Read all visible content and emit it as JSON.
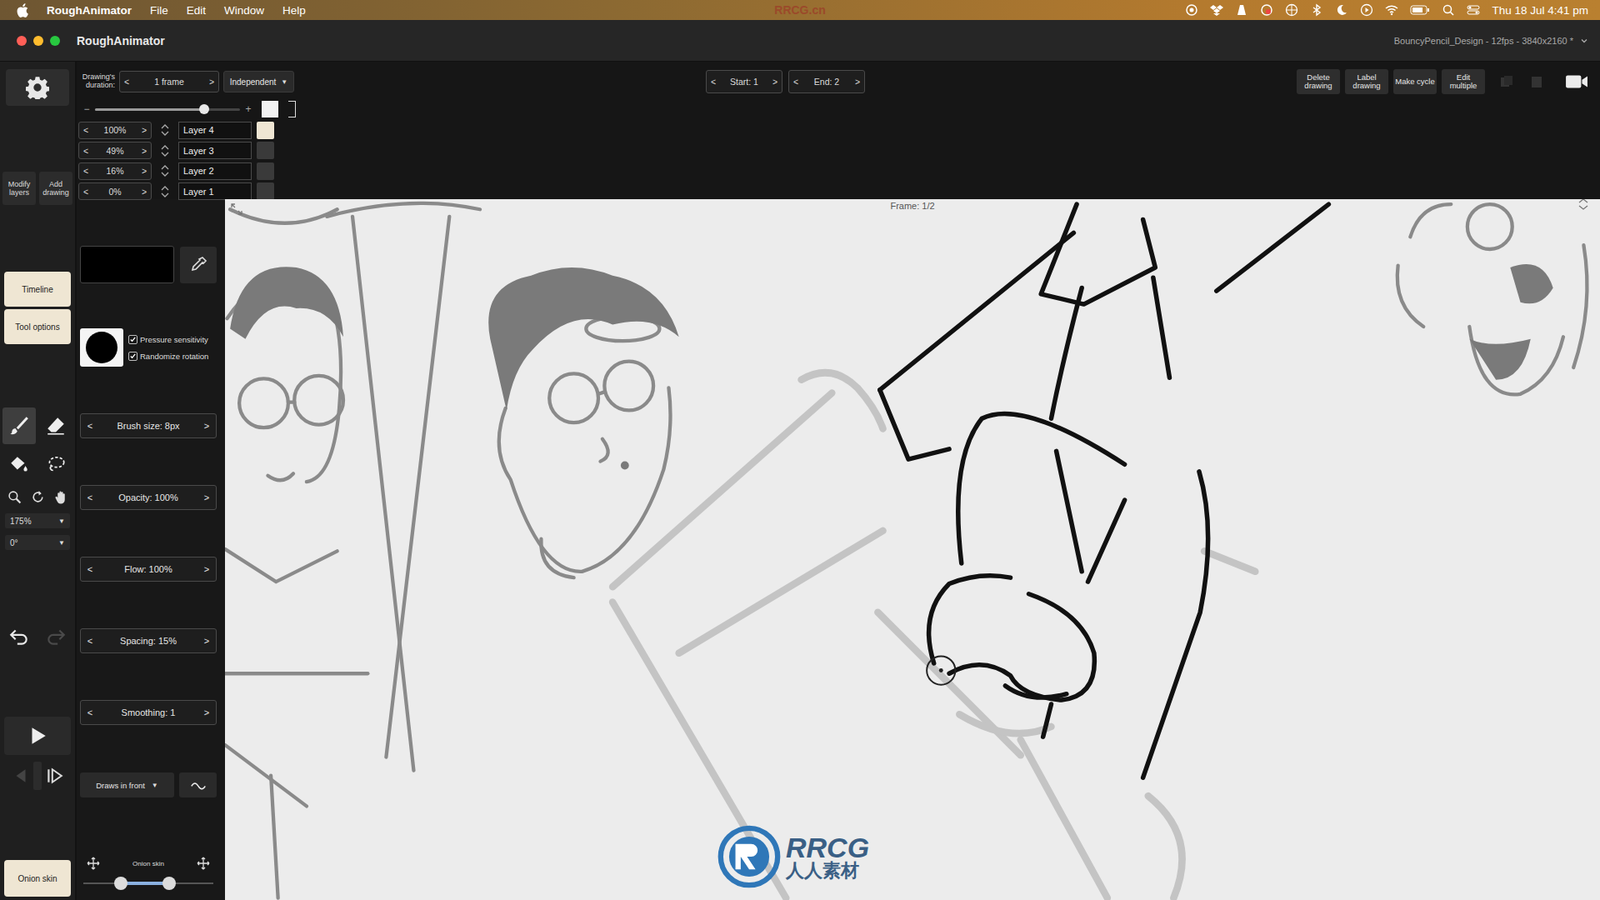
{
  "menubar": {
    "app": "RoughAnimator",
    "menus": [
      "File",
      "Edit",
      "Window",
      "Help"
    ],
    "watermark": "RRCG.cn",
    "clock": "Thu 18 Jul  4:41 pm"
  },
  "window": {
    "title": "RoughAnimator",
    "document": "BouncyPencil_Design - 12fps - 3840x2160 *"
  },
  "toolbar": {
    "duration_label": "Drawing's duration:",
    "duration": "1 frame",
    "prev": "<",
    "next": ">",
    "mode": "Independent",
    "caret": "▼",
    "start": "Start: 1",
    "end": "End: 2",
    "actions": [
      "Delete drawing",
      "Label drawing",
      "Make cycle",
      "Edit multiple"
    ]
  },
  "opacity_slider": {
    "minus": "−",
    "plus": "+",
    "level": 0.75
  },
  "layers": [
    {
      "opacity": "100%",
      "name": "Layer 4",
      "selected": true
    },
    {
      "opacity": "49%",
      "name": "Layer 3",
      "selected": false
    },
    {
      "opacity": "16%",
      "name": "Layer 2",
      "selected": false
    },
    {
      "opacity": "0%",
      "name": "Layer 1",
      "selected": false
    }
  ],
  "sidebar": {
    "layer_buttons": [
      "Modify layers",
      "Add drawing"
    ],
    "panels": [
      "Timeline",
      "Tool options"
    ],
    "tools": [
      {
        "kind": "brush",
        "selected": true
      },
      {
        "kind": "eraser",
        "selected": false
      },
      {
        "kind": "fill",
        "selected": false
      },
      {
        "kind": "lasso",
        "selected": false
      }
    ],
    "view_tools": [
      {
        "kind": "zoom",
        "selected": false
      },
      {
        "kind": "rotate",
        "selected": false
      },
      {
        "kind": "pan",
        "selected": false
      }
    ],
    "zoom": "175%",
    "rotation": "0°",
    "undo_enabled": true,
    "redo_enabled": false,
    "onion_skin": "Onion skin"
  },
  "tool_options": {
    "brush_color": "#000000",
    "checkboxes": [
      {
        "label": "Pressure sensitivity",
        "checked": true
      },
      {
        "label": "Randomize rotation",
        "checked": true
      }
    ],
    "settings": [
      "Brush size: 8px",
      "Opacity: 100%",
      "Flow: 100%",
      "Spacing: 15%",
      "Smoothing: 1"
    ],
    "draw_order": "Draws in front",
    "onion_label": "Onion skin",
    "onion_low": 0.3,
    "onion_high": 0.65
  },
  "canvas": {
    "frame": "Frame: 1/2"
  },
  "watermark": {
    "logo": "RRCG",
    "subtitle": "人人素材"
  }
}
